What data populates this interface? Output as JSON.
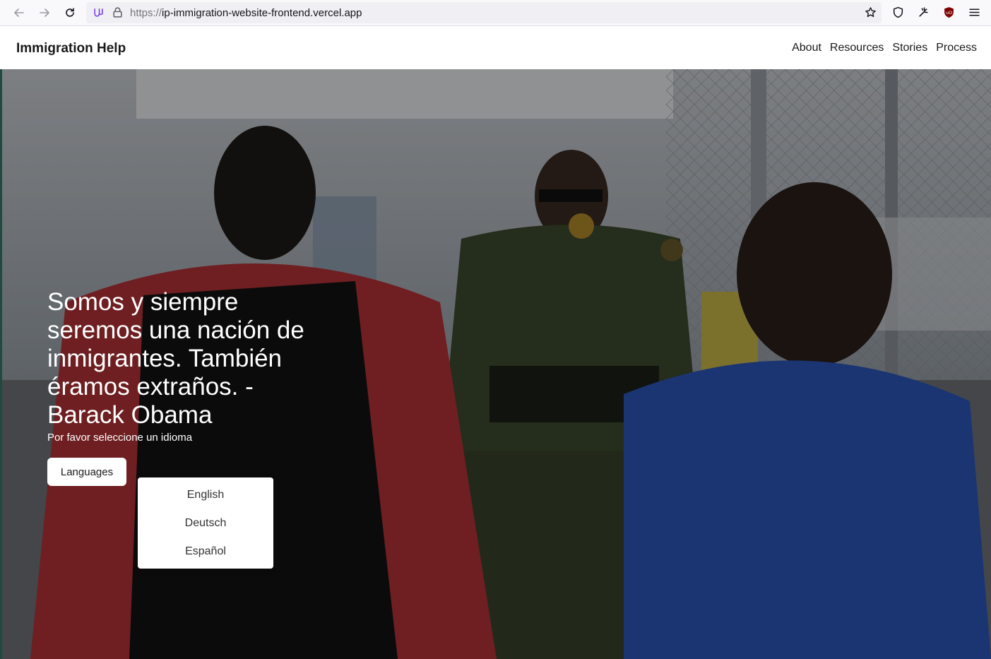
{
  "browser": {
    "url_scheme": "https://",
    "url_host": "ip-immigration-website-frontend.vercel.app"
  },
  "header": {
    "brand": "Immigration Help",
    "nav": [
      "About",
      "Resources",
      "Stories",
      "Process"
    ]
  },
  "hero": {
    "quote": "Somos y siempre seremos una nación de inmigrantes. También éramos extraños. - Barack Obama",
    "subtext": "Por favor seleccione un idioma",
    "button_label": "Languages",
    "languages": [
      "English",
      "Deutsch",
      "Español"
    ]
  },
  "icons": {
    "back": "arrow-left-icon",
    "forward": "arrow-right-icon",
    "reload": "reload-icon",
    "bookmark": "star-icon",
    "shield": "shield-icon",
    "extensions": "sparkle-icon",
    "ublock": "ublock-icon",
    "menu": "hamburger-menu-icon"
  }
}
